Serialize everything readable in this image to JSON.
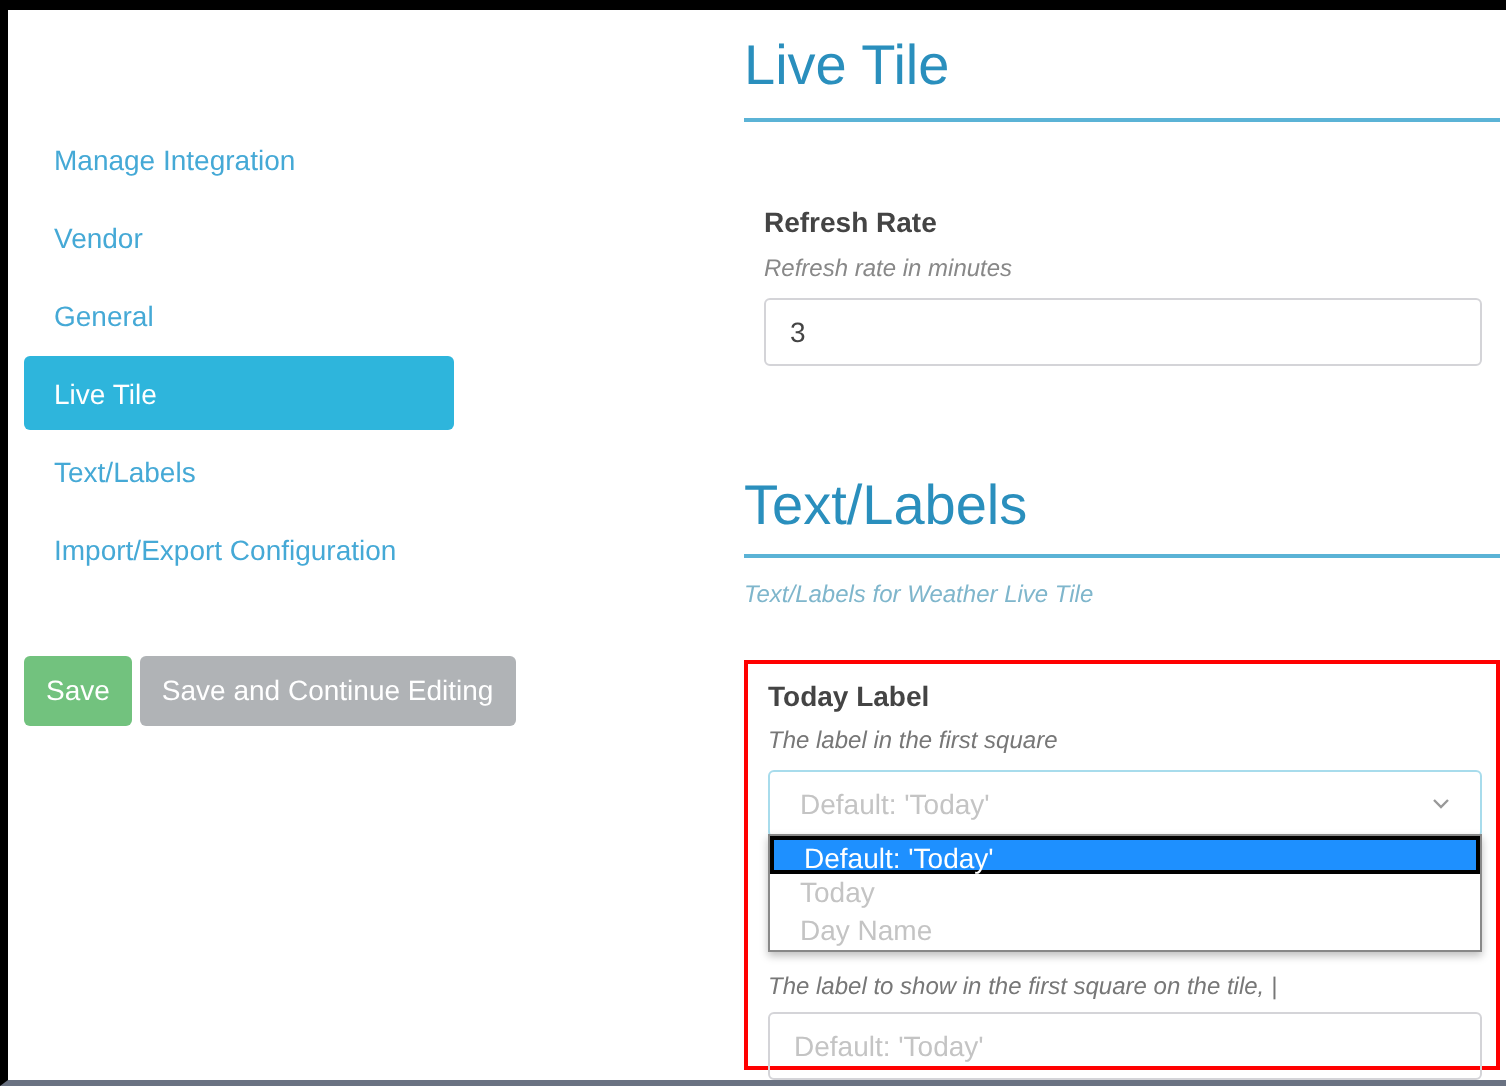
{
  "sidebar": {
    "items": [
      {
        "label": "Manage Integration",
        "selected": false
      },
      {
        "label": "Vendor",
        "selected": false
      },
      {
        "label": "General",
        "selected": false
      },
      {
        "label": "Live Tile",
        "selected": true
      },
      {
        "label": "Text/Labels",
        "selected": false
      },
      {
        "label": "Import/Export Configuration",
        "selected": false
      }
    ]
  },
  "buttons": [
    {
      "label": "Save",
      "kind": "primary"
    },
    {
      "label": "Save and Continue Editing",
      "kind": "secondary"
    }
  ],
  "live_tile": {
    "heading": "Live Tile",
    "field": {
      "label": "Refresh Rate",
      "hint": "Refresh rate in minutes",
      "value": "3"
    }
  },
  "text_labels": {
    "heading": "Text/Labels",
    "description": "Text/Labels for Weather Live Tile",
    "today_label": {
      "label": "Today Label",
      "hint": "The label in the first square",
      "select_value": "Default: 'Today'",
      "options": [
        {
          "label": "Default: 'Today'",
          "selected": true
        },
        {
          "label": "Today",
          "selected": false
        },
        {
          "label": "Day Name",
          "selected": false
        }
      ],
      "help": "The label to show in the first square on the tile, |",
      "input_placeholder": "Default: 'Today'"
    }
  }
}
